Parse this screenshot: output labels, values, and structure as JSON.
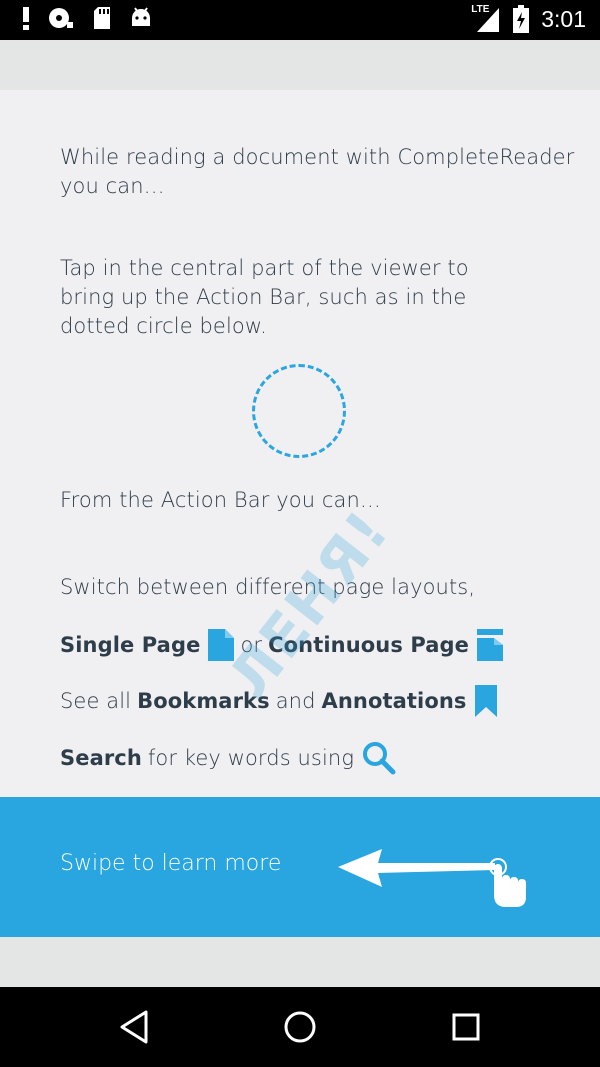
{
  "status_bar": {
    "time": "3:01",
    "network": "LTE",
    "icons": [
      "alert-icon",
      "disc-icon",
      "sd-card-icon",
      "android-icon",
      "signal-icon",
      "battery-charging-icon"
    ]
  },
  "content": {
    "intro": "While reading a document with CompleteReader you can…",
    "tap_instruction": "Tap in the central part of the viewer to bring up the Action Bar, such as in the dotted circle below.",
    "action_bar_heading": "From the Action Bar you can…",
    "switch_layouts": "Switch between different page layouts,",
    "single_page": "Single Page",
    "or": "or",
    "continuous_page": "Continuous Page",
    "see_all": "See all",
    "bookmarks": "Bookmarks",
    "and": "and",
    "annotations": "Annotations",
    "search": "Search",
    "search_suffix": "for key words using"
  },
  "watermark": "ЛЕНЯ!",
  "banner": {
    "swipe_text": "Swipe to learn more"
  },
  "colors": {
    "accent": "#29a5e0",
    "text": "#2e3d4a",
    "card_bg": "#f0eff1",
    "page_bg": "#e4e6e5"
  },
  "nav_bar": {
    "buttons": [
      "back-icon",
      "home-icon",
      "recents-icon"
    ]
  }
}
